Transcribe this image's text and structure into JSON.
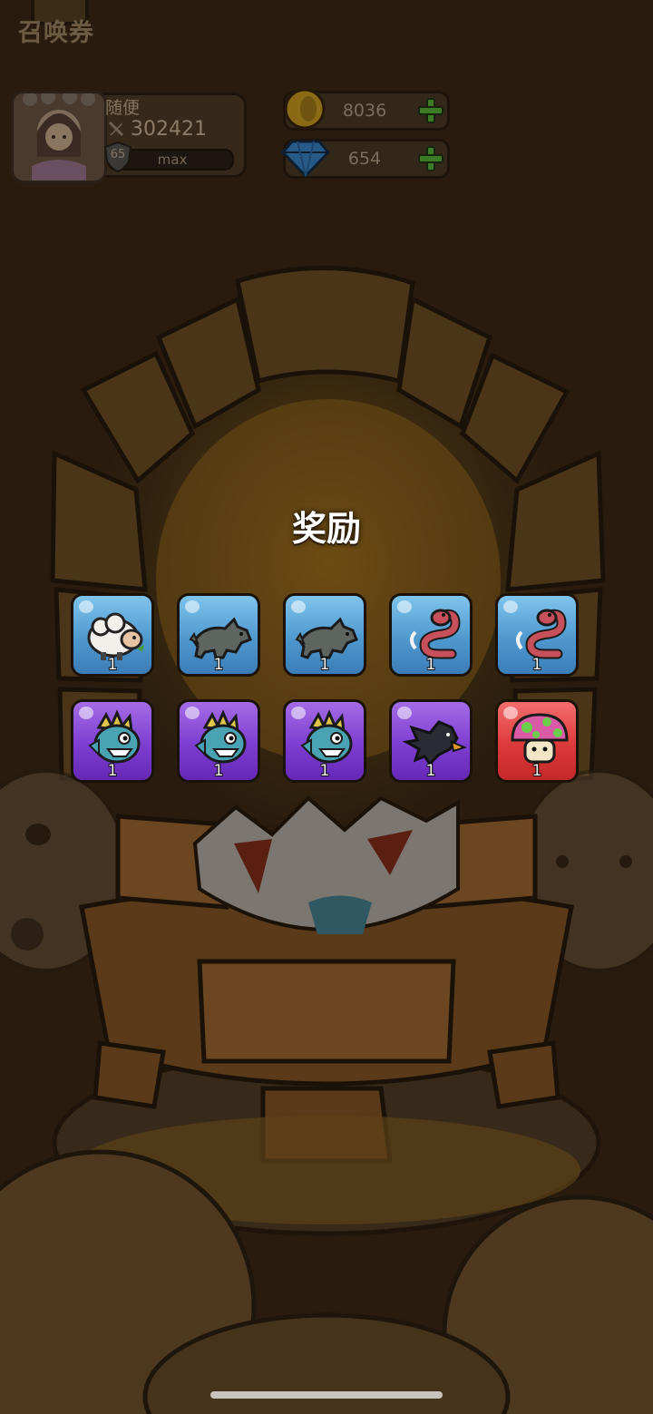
{
  "header": {
    "ticket_label": "召唤券"
  },
  "profile": {
    "name": "随便",
    "power": "302421",
    "level": "65",
    "xp_label": "max"
  },
  "currencies": {
    "coins": "8036",
    "gems": "654"
  },
  "rewards": {
    "title": "奖励",
    "items": [
      {
        "icon": "sheep-icon",
        "rarity": "blue",
        "count": "1"
      },
      {
        "icon": "wolf-icon",
        "rarity": "blue",
        "count": "1"
      },
      {
        "icon": "wolf-icon",
        "rarity": "blue",
        "count": "1"
      },
      {
        "icon": "snake-icon",
        "rarity": "blue",
        "count": "1"
      },
      {
        "icon": "snake-icon",
        "rarity": "blue",
        "count": "1"
      },
      {
        "icon": "fish-monster-icon",
        "rarity": "purple",
        "count": "1"
      },
      {
        "icon": "fish-monster-icon",
        "rarity": "purple",
        "count": "1"
      },
      {
        "icon": "fish-monster-icon",
        "rarity": "purple",
        "count": "1"
      },
      {
        "icon": "crow-icon",
        "rarity": "purple",
        "count": "1"
      },
      {
        "icon": "mushroom-icon",
        "rarity": "red",
        "count": "1"
      }
    ]
  },
  "colors": {
    "tile_blue": "#4f99cf",
    "tile_purple": "#7d3ed1",
    "tile_red": "#dd3a3a",
    "plus_green": "#3f9a2c",
    "coin_gold": "#b58c1a",
    "gem_blue": "#2f6ea8"
  }
}
